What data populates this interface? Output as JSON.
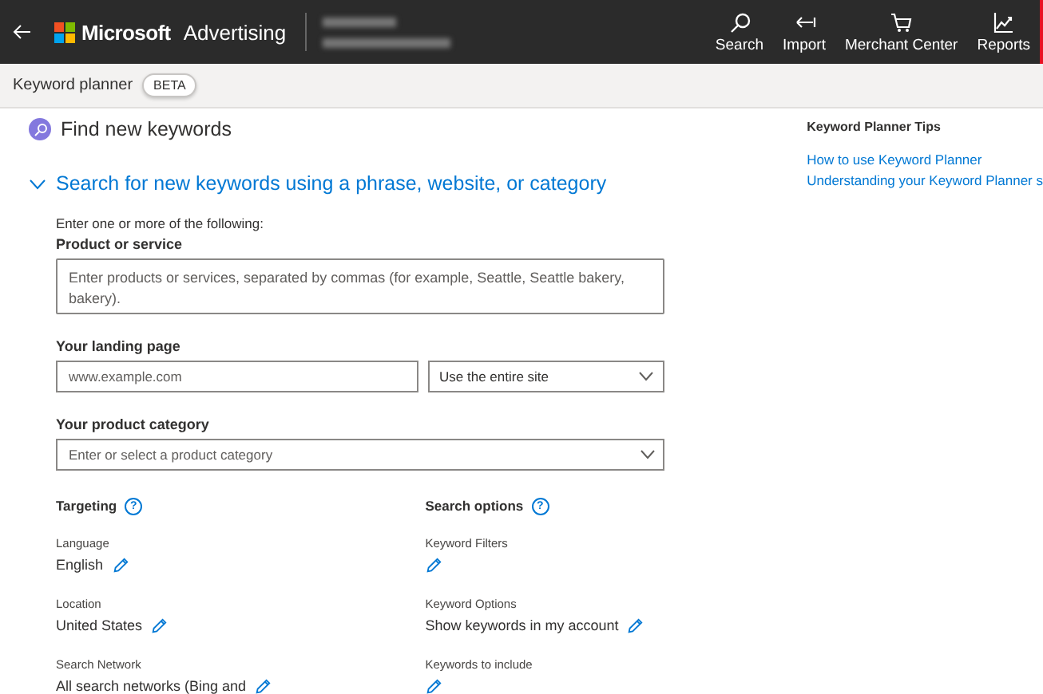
{
  "header": {
    "brand": "Microsoft",
    "product": "Advertising",
    "actions": [
      {
        "label": "Search",
        "kind": "search"
      },
      {
        "label": "Import",
        "kind": "import"
      },
      {
        "label": "Merchant Center",
        "kind": "cart"
      },
      {
        "label": "Reports",
        "kind": "chart"
      }
    ]
  },
  "subheader": {
    "title": "Keyword planner",
    "badge": "BETA"
  },
  "page_title": "Find new keywords",
  "section": {
    "title": "Search for new keywords using a phrase, website, or category",
    "expanded": true,
    "intro": "Enter one or more of the following:",
    "product": {
      "label": "Product or service",
      "placeholder": "Enter products or services, separated by commas (for example, Seattle, Seattle bakery, bakery)."
    },
    "landing": {
      "label": "Your landing page",
      "placeholder": "www.example.com",
      "scope": "Use the entire site"
    },
    "category": {
      "label": "Your product category",
      "placeholder": "Enter or select a product category"
    },
    "columns": [
      {
        "title": "Targeting",
        "help": "?",
        "items": [
          {
            "label": "Language",
            "value": "English"
          },
          {
            "label": "Location",
            "value": "United States"
          },
          {
            "label": "Search Network",
            "value": "All search networks (Bing and"
          }
        ]
      },
      {
        "title": "Search options",
        "help": "?",
        "items": [
          {
            "label": "Keyword Filters"
          },
          {
            "label": "Keyword Options",
            "value": "Show keywords in my account"
          },
          {
            "label": "Keywords to include"
          }
        ]
      }
    ]
  },
  "tips": {
    "title": "Keyword Planner Tips",
    "links": [
      "How to use Keyword Planner",
      "Understanding your Keyword Planner s"
    ]
  }
}
